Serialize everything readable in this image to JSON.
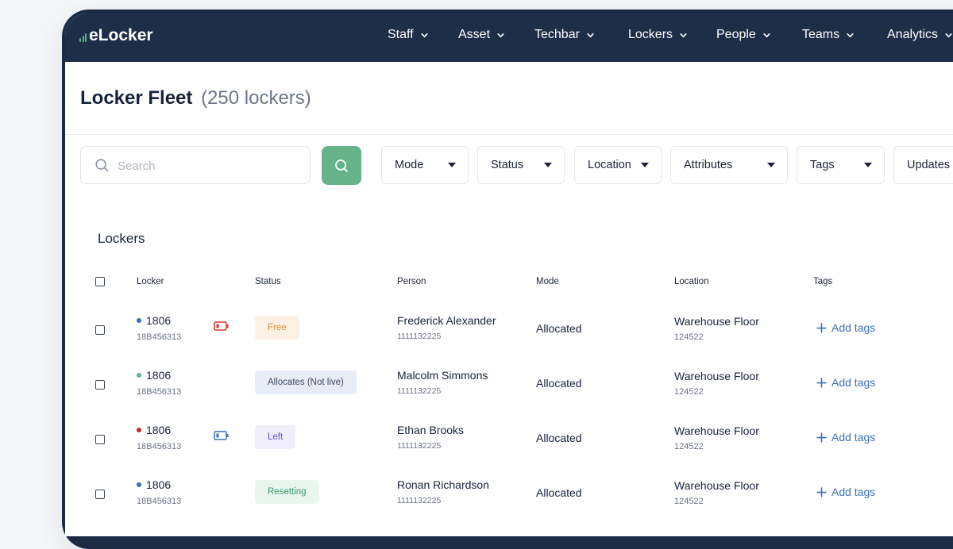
{
  "app": {
    "logo_text": "eLocker"
  },
  "nav": {
    "items": [
      {
        "label": "Staff"
      },
      {
        "label": "Asset"
      },
      {
        "label": "Techbar"
      },
      {
        "label": "Lockers"
      },
      {
        "label": "People"
      },
      {
        "label": "Teams"
      },
      {
        "label": "Analytics"
      }
    ]
  },
  "page": {
    "title": "Locker Fleet",
    "count": "(250 lockers)"
  },
  "search": {
    "placeholder": "Search",
    "value": ""
  },
  "filters": [
    {
      "label": "Mode"
    },
    {
      "label": "Status"
    },
    {
      "label": "Location"
    },
    {
      "label": "Attributes"
    },
    {
      "label": "Tags"
    },
    {
      "label": "Updates"
    }
  ],
  "table": {
    "section_title": "Lockers",
    "columns": [
      "Locker",
      "Status",
      "Person",
      "Mode",
      "Location",
      "Tags"
    ],
    "rows": [
      {
        "locker": "1806",
        "code": "18B456313",
        "dot_color": "#3b6fb6",
        "battery": "low",
        "status": "Free",
        "status_bg": "#fdf1e4",
        "status_fg": "#e08a3a",
        "person": "Frederick Alexander",
        "person_id": "1111132225",
        "mode": "Allocated",
        "location": "Warehouse Floor",
        "location_id": "124522",
        "tags_label": "Add tags"
      },
      {
        "locker": "1806",
        "code": "18B456313",
        "dot_color": "#5fb58a",
        "battery": "none",
        "status": "Allocates (Not live)",
        "status_bg": "#e8ecf6",
        "status_fg": "#3d4a63",
        "person": "Malcolm Simmons",
        "person_id": "1111132225",
        "mode": "Allocated",
        "location": "Warehouse Floor",
        "location_id": "124522",
        "tags_label": "Add tags"
      },
      {
        "locker": "1806",
        "code": "18B456313",
        "dot_color": "#c62b2b",
        "battery": "mid",
        "status": "Left",
        "status_bg": "#f1eefc",
        "status_fg": "#6a4fd8",
        "person": "Ethan Brooks",
        "person_id": "1111132225",
        "mode": "Allocated",
        "location": "Warehouse Floor",
        "location_id": "124522",
        "tags_label": "Add tags"
      },
      {
        "locker": "1806",
        "code": "18B456313",
        "dot_color": "#3b6fb6",
        "battery": "none",
        "status": "Resetting",
        "status_bg": "#e9f6ef",
        "status_fg": "#3d9a6a",
        "person": "Ronan Richardson",
        "person_id": "1111132225",
        "mode": "Allocated",
        "location": "Warehouse Floor",
        "location_id": "124522",
        "tags_label": "Add tags"
      }
    ]
  },
  "colors": {
    "nav_bg": "#1e2d48",
    "accent_green": "#66b389",
    "link_blue": "#3b71b8",
    "battery_low": "#d43a2a",
    "battery_mid": "#3b71b8"
  }
}
